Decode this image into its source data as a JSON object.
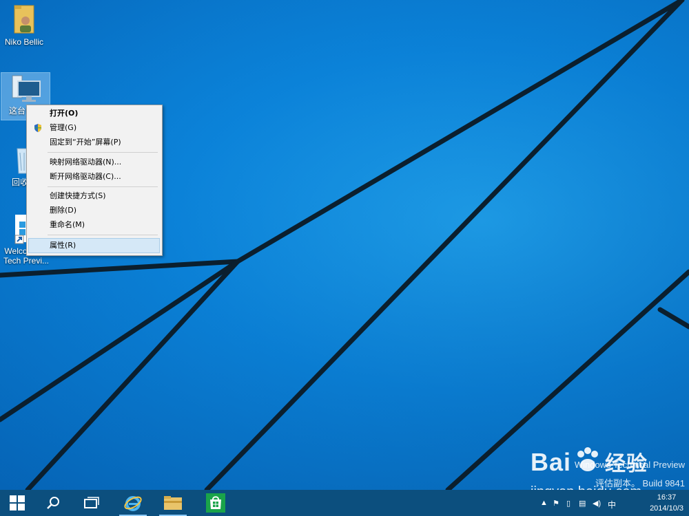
{
  "desktop": {
    "icons": [
      {
        "label": "Niko Bellic",
        "icon": "user-folder-icon"
      },
      {
        "label": "这台电脑",
        "icon": "computer-icon"
      },
      {
        "label": "回收站",
        "icon": "recycle-bin-icon"
      },
      {
        "label": "Welcome to Tech Previ...",
        "icon": "shortcut-icon"
      }
    ]
  },
  "context_menu": {
    "items": [
      {
        "label": "打开(O)",
        "bold": true
      },
      {
        "label": "管理(G)",
        "icon": "uac-shield-icon"
      },
      {
        "label": "固定到“开始”屏幕(P)"
      },
      {
        "label": "映射网络驱动器(N)..."
      },
      {
        "label": "断开网络驱动器(C)..."
      },
      {
        "label": "创建快捷方式(S)"
      },
      {
        "label": "删除(D)"
      },
      {
        "label": "重命名(M)"
      },
      {
        "label": "属性(R)",
        "highlighted": true
      }
    ]
  },
  "watermark": {
    "line1": "Windows Technical Preview",
    "line2": "评估副本。 Build 9841",
    "brand": "Bai",
    "brand_tail": "经验",
    "url": "jingyan.baidu.com"
  },
  "taskbar": {
    "buttons": [
      {
        "name": "start",
        "icon": "windows-logo-icon"
      },
      {
        "name": "search",
        "icon": "search-icon"
      },
      {
        "name": "task-view",
        "icon": "task-view-icon"
      },
      {
        "name": "internet-explorer",
        "icon": "ie-icon"
      },
      {
        "name": "file-explorer",
        "icon": "folder-icon"
      },
      {
        "name": "store",
        "icon": "store-icon"
      }
    ],
    "tray": {
      "ime": "中",
      "time": "16:37",
      "date": "2014/10/3"
    }
  },
  "colors": {
    "desktop": "#0c86dd",
    "taskbar": "#0c4f7e",
    "menu_bg": "#f2f2f2",
    "menu_highlight": "#d5e8f7"
  }
}
